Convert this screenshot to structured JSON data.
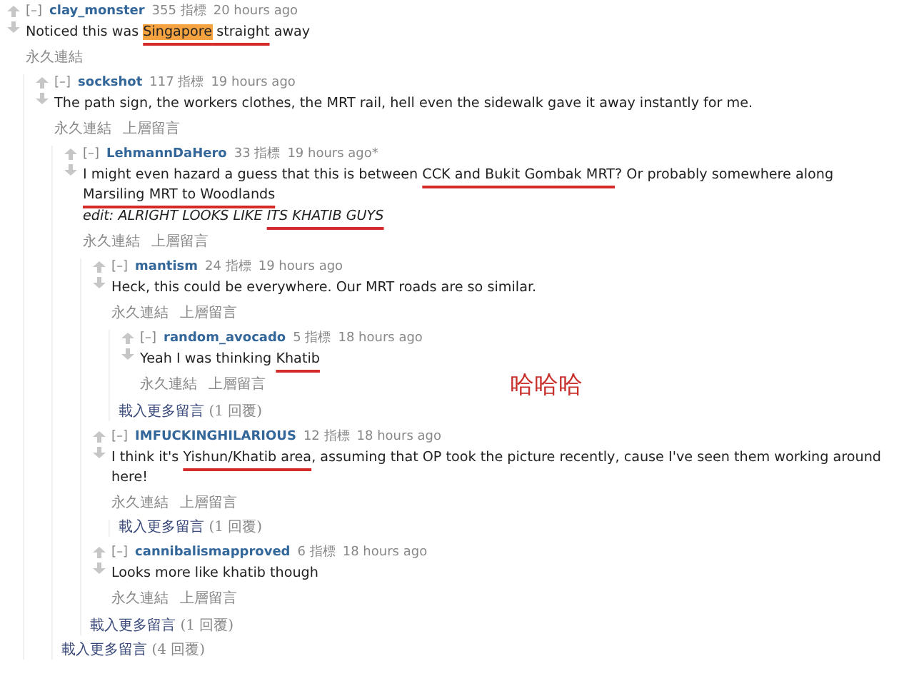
{
  "comments": [
    {
      "kind": "comment",
      "collapse": "[–]",
      "author": "clay_monster",
      "score": "355 指標",
      "time": "20 hours ago",
      "body": [
        {
          "text": "Noticed this was "
        },
        {
          "text": "Singapore",
          "highlighted": true,
          "underlined": true
        },
        {
          "text": " straight",
          "underlined": true
        },
        {
          "text": " away"
        }
      ],
      "links": [
        "永久連結"
      ],
      "children": [
        {
          "kind": "comment",
          "collapse": "[–]",
          "author": "sockshot",
          "score": "117 指標",
          "time": "19 hours ago",
          "body": [
            {
              "text": "The path sign, the workers clothes, the MRT rail, hell even the sidewalk gave it away instantly for me."
            }
          ],
          "links": [
            "永久連結",
            "上層留言"
          ],
          "children": [
            {
              "kind": "comment",
              "collapse": "[–]",
              "author": "LehmannDaHero",
              "score": "33 指標",
              "time": "19 hours ago*",
              "body": [
                {
                  "text": "I might even hazard a guess that this is between "
                },
                {
                  "text": "CCK and Bukit Gombak MRT",
                  "underlined": true
                },
                {
                  "text": "? Or probably somewhere along "
                },
                {
                  "text": "Marsiling MRT to Woodlands",
                  "underlined": true
                }
              ],
              "edit": [
                {
                  "text": "edit: ALRIGHT LOOKS LIKE "
                },
                {
                  "text": "ITS KHATIB GUYS",
                  "underlined": true
                }
              ],
              "links": [
                "永久連結",
                "上層留言"
              ],
              "children": [
                {
                  "kind": "comment",
                  "collapse": "[–]",
                  "author": "mantism",
                  "score": "24 指標",
                  "time": "19 hours ago",
                  "body": [
                    {
                      "text": "Heck, this could be everywhere. Our MRT roads are so similar."
                    }
                  ],
                  "links": [
                    "永久連結",
                    "上層留言"
                  ],
                  "children": [
                    {
                      "kind": "comment",
                      "collapse": "[–]",
                      "author": "random_avocado",
                      "score": "5 指標",
                      "time": "18 hours ago",
                      "body": [
                        {
                          "text": "Yeah I was thinking "
                        },
                        {
                          "text": "Khatib",
                          "underlined": true
                        }
                      ],
                      "links": [
                        "永久連結",
                        "上層留言"
                      ]
                    },
                    {
                      "kind": "more",
                      "label": "載入更多留言",
                      "count": "(1 回覆)"
                    }
                  ]
                },
                {
                  "kind": "comment",
                  "collapse": "[–]",
                  "author": "IMFUCKINGHILARIOUS",
                  "score": "12 指標",
                  "time": "18 hours ago",
                  "body": [
                    {
                      "text": "I think it's "
                    },
                    {
                      "text": "Yishun/Khatib area",
                      "underlined": true
                    },
                    {
                      "text": ", assuming that OP took the picture recently, cause I've seen them working around here!"
                    }
                  ],
                  "links": [
                    "永久連結",
                    "上層留言"
                  ],
                  "children": [
                    {
                      "kind": "more",
                      "label": "載入更多留言",
                      "count": "(1 回覆)"
                    }
                  ]
                },
                {
                  "kind": "comment",
                  "collapse": "[–]",
                  "author": "cannibalismapproved",
                  "score": "6 指標",
                  "time": "18 hours ago",
                  "body": [
                    {
                      "text": "Looks more like khatib though"
                    }
                  ],
                  "links": [
                    "永久連結",
                    "上層留言"
                  ]
                },
                {
                  "kind": "more",
                  "label": "載入更多留言",
                  "count": "(1 回覆)"
                }
              ]
            },
            {
              "kind": "more",
              "label": "載入更多留言",
              "count": "(4 回覆)"
            }
          ]
        }
      ]
    }
  ],
  "annotation": "哈哈哈"
}
